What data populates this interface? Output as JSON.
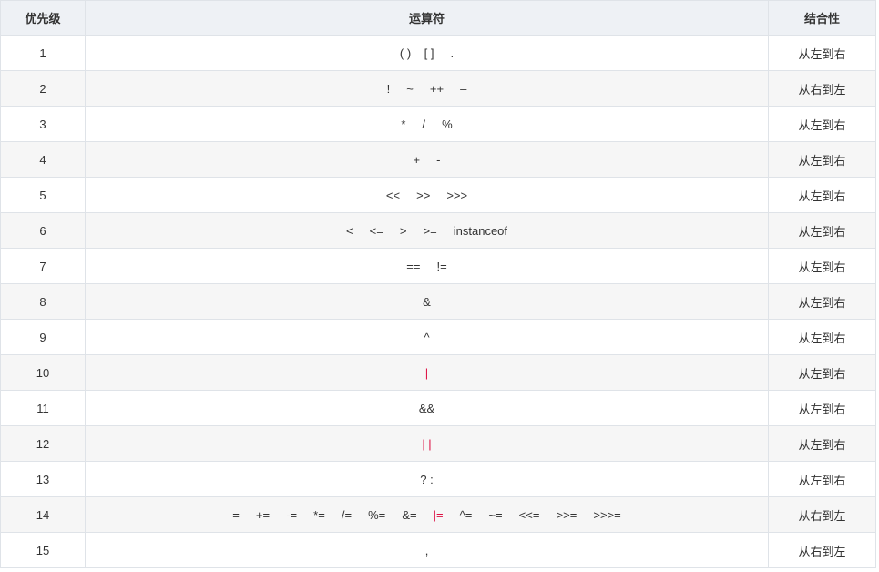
{
  "table": {
    "headers": {
      "priority": "优先级",
      "operators": "运算符",
      "associativity": "结合性"
    },
    "rows": [
      {
        "priority": "1",
        "operators": "( )    [ ]     .",
        "associativity": "从左到右",
        "highlight": false
      },
      {
        "priority": "2",
        "operators": "!     ~     ++     –",
        "associativity": "从右到左",
        "highlight": false
      },
      {
        "priority": "3",
        "operators": "*     /     %",
        "associativity": "从左到右",
        "highlight": false
      },
      {
        "priority": "4",
        "operators": "+     -",
        "associativity": "从左到右",
        "highlight": false
      },
      {
        "priority": "5",
        "operators": "<<     >>     >>>",
        "associativity": "从左到右",
        "highlight": false
      },
      {
        "priority": "6",
        "operators": "<     <=     >     >=     instanceof",
        "associativity": "从左到右",
        "highlight": false
      },
      {
        "priority": "7",
        "operators": "==     !=",
        "associativity": "从左到右",
        "highlight": false
      },
      {
        "priority": "8",
        "operators": "&",
        "associativity": "从左到右",
        "highlight": false
      },
      {
        "priority": "9",
        "operators": "^",
        "associativity": "从左到右",
        "highlight": false
      },
      {
        "priority": "10",
        "operators": "|",
        "associativity": "从左到右",
        "highlight": true
      },
      {
        "priority": "11",
        "operators": "&&",
        "associativity": "从左到右",
        "highlight": false
      },
      {
        "priority": "12",
        "operators": "| |",
        "associativity": "从左到右",
        "highlight": true
      },
      {
        "priority": "13",
        "operators": "? :",
        "associativity": "从左到右",
        "highlight": false
      },
      {
        "priority": "14",
        "operators_before": "=     +=     -=     *=     /=     %=     &=     ",
        "operators_highlight": "|=",
        "operators_after": "     ^=     ~=     <<=     >>=     >>>=",
        "associativity": "从右到左",
        "highlight": false
      },
      {
        "priority": "15",
        "operators": ",",
        "associativity": "从右到左",
        "highlight": false
      }
    ]
  },
  "colors": {
    "header_bg": "#eef1f5",
    "stripe_bg": "#f6f6f6",
    "border": "#dfe3e8",
    "text": "#333333",
    "highlight_text": "#dd1144"
  }
}
